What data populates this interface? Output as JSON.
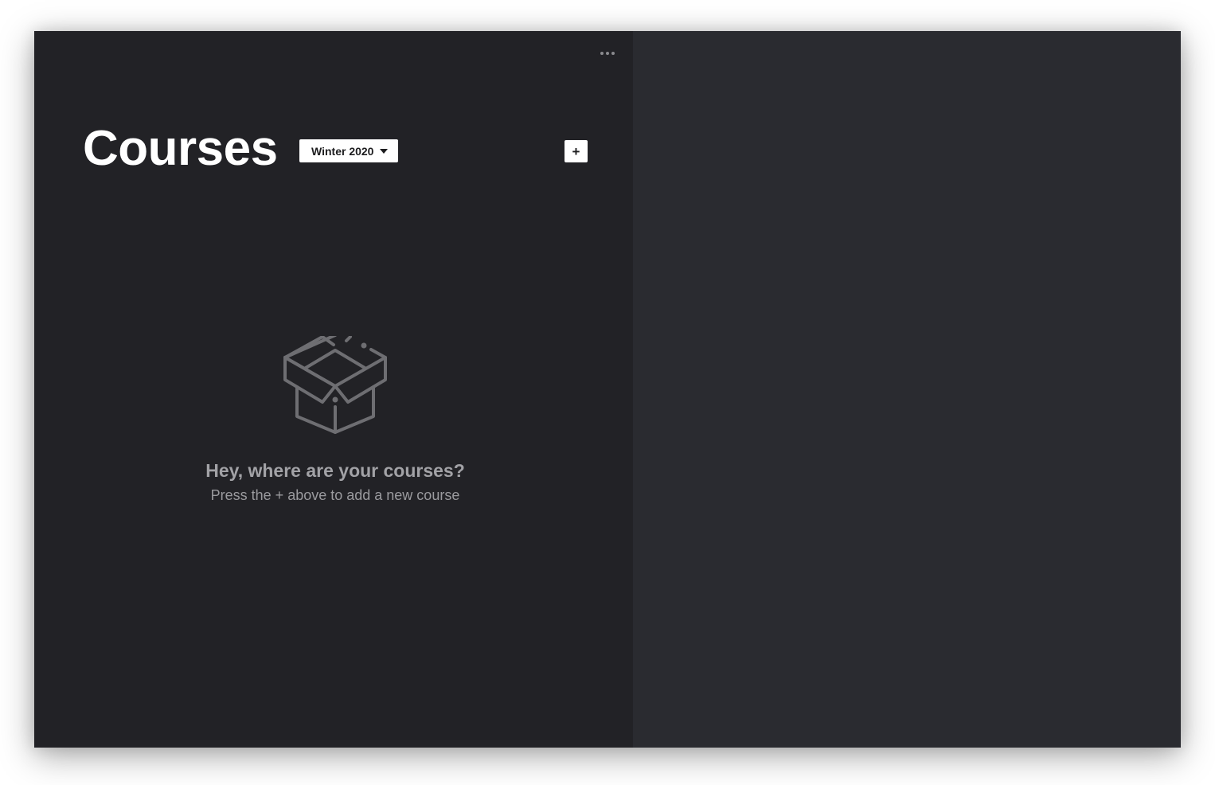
{
  "header": {
    "title": "Courses",
    "term_selected": "Winter 2020",
    "add_label": "+"
  },
  "empty_state": {
    "title": "Hey, where are your courses?",
    "subtitle": "Press the + above to add a new course",
    "icon": "open-box-icon"
  },
  "menu": {
    "icon": "more-horizontal-icon"
  },
  "colors": {
    "left_pane": "#222226",
    "right_pane": "#2a2b30",
    "title": "#ffffff",
    "muted_text": "#a2a2a6",
    "icon_stroke": "#6e6e72"
  }
}
